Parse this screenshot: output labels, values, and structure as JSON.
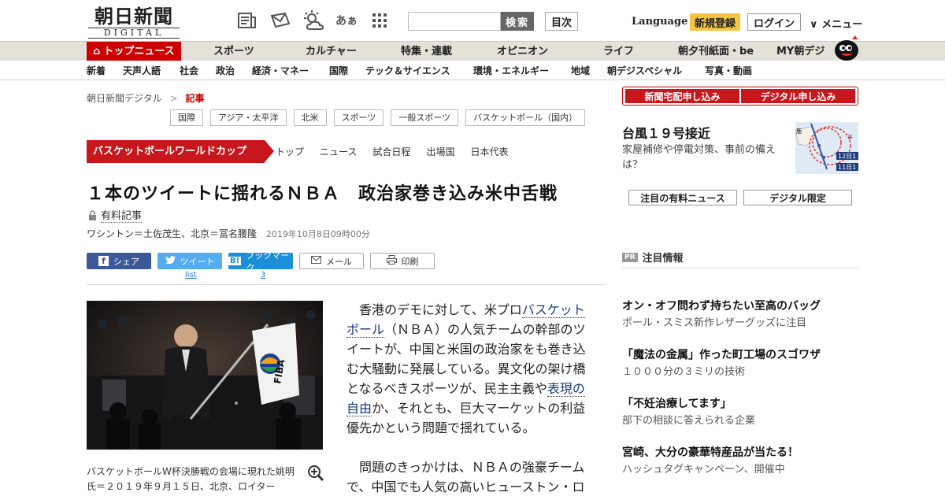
{
  "logo": {
    "name": "朝日新聞",
    "sub": "DIGITAL"
  },
  "header": {
    "icons": [
      "newspaper-icon",
      "mail-icon",
      "weather-icon",
      "font-size-icon",
      "grid-icon"
    ],
    "font_glyph": "あぁ",
    "search_placeholder": "",
    "search_label": "検索",
    "mokuji_label": "目次",
    "language_label": "Language",
    "register_label": "新規登録",
    "login_label": "ログイン",
    "menu_label": "∨ メニュー"
  },
  "nav1": [
    "トップニュース",
    "スポーツ",
    "カルチャー",
    "特集・連載",
    "オピニオン",
    "ライフ",
    "朝夕刊紙面・be",
    "MY朝デジ"
  ],
  "nav2": [
    "新着",
    "天声人語",
    "社会",
    "政治",
    "経済・マネー",
    "国際",
    "テック＆サイエンス",
    "環境・エネルギー",
    "地域",
    "朝デジスペシャル",
    "写真・動画"
  ],
  "breadcrumb": {
    "home": "朝日新聞デジタル",
    "sep": ">",
    "current": "記事"
  },
  "tags": [
    "国際",
    "アジア・太平洋",
    "北米",
    "スポーツ",
    "一般スポーツ",
    "バスケットボール（国内）"
  ],
  "worldcup": {
    "banner": "バスケットボールワールドカップ",
    "menu": [
      "トップ",
      "ニュース",
      "試合日程",
      "出場国",
      "日本代表"
    ]
  },
  "article": {
    "headline": "１本のツイートに揺れるＮＢＡ　政治家巻き込み米中舌戦",
    "paid_label": "有料記事",
    "byline": "ワシントン＝土佐茂生、北京＝冨名腰隆",
    "date": "2019年10月8日09時00分",
    "caption": "バスケットボールW杯決勝戦の会場に現れた姚明氏＝２０１９年９月１５日、北京、ロイター",
    "flag_text": "FIBA",
    "p1_a": "香港のデモに対して、米プロ",
    "p1_link1": "バスケットボール",
    "p1_b": "（ＮＢＡ）の人気チームの幹部のツイートが、中国と米国の政治家をも巻き込む大騒動に発展している。異文化の架け橋となるべきスポーツが、民主主義や",
    "p1_link2": "表現の自由",
    "p1_c": "か、それとも、巨大マーケットの利益優先かという問題で揺れている。",
    "p2": "問題のきっかけは、ＮＢＡの強豪チームで、中国でも人気の高いヒューストン・ロ"
  },
  "share": {
    "facebook": "シェア",
    "twitter": "ツイート",
    "hatena": "ブックマーク",
    "hatena_glyph": "B!",
    "mail": "メール",
    "print": "印刷",
    "twitter_count": "list",
    "hatena_count": "3"
  },
  "right": {
    "subscribe_paper": "新聞宅配申し込み",
    "subscribe_digital": "デジタル申し込み",
    "typhoon_title": "台風１９号接近",
    "typhoon_sub": "家屋補修や停電対策、事前の備えは？",
    "map_labels": [
      "12日1",
      "11日1",
      "予",
      "鹿"
    ],
    "tab_paid": "注目の有料ニュース",
    "tab_digital": "デジタル限定",
    "pr_badge": "PR",
    "pr_title": "注目情報",
    "pr_items": [
      {
        "title": "オン・オフ問わず持ちたい至高のバッグ",
        "sub": "ポール・スミス新作レザーグッズに注目"
      },
      {
        "title": "「魔法の金属」作った町工場のスゴワザ",
        "sub": "１０００分の３ミリの技術"
      },
      {
        "title": "「不妊治療してます」",
        "sub": "部下の相談に答えられる企業"
      },
      {
        "title": "宮崎、大分の豪華特産品が当たる！",
        "sub": "ハッシュタグキャンペーン、開催中"
      }
    ]
  }
}
